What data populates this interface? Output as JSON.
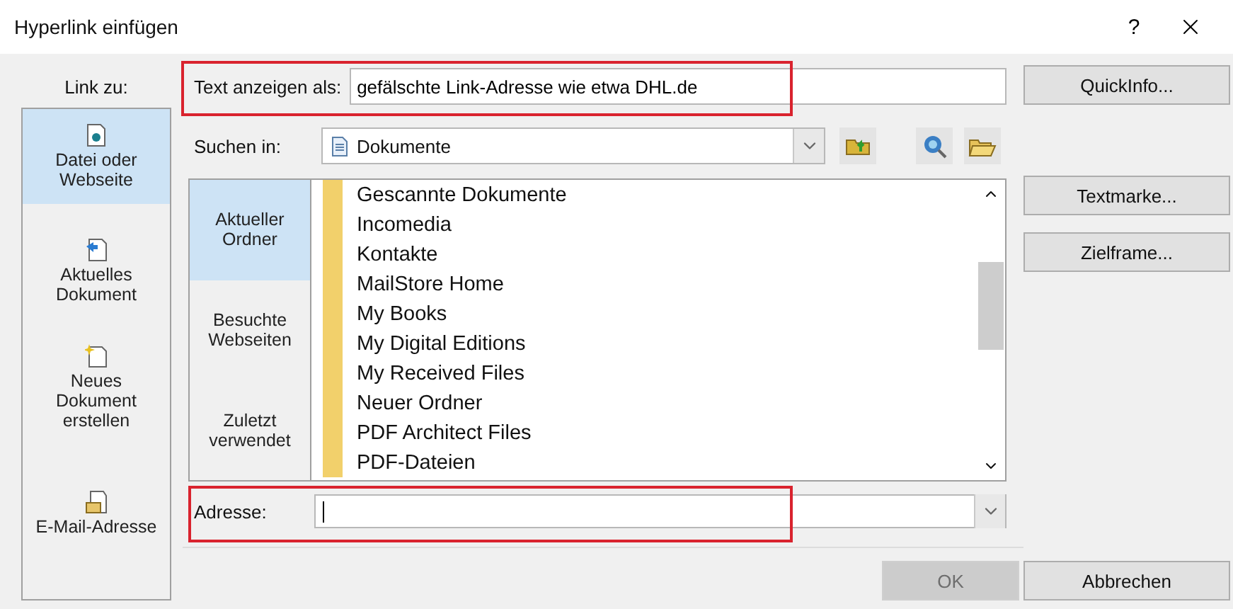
{
  "window": {
    "title": "Hyperlink einfügen",
    "help": "?"
  },
  "link_to": {
    "label": "Link zu:",
    "items": [
      {
        "kind": "file",
        "label": "Datei oder\nWebseite",
        "selected": true
      },
      {
        "kind": "document",
        "label": "Aktuelles\nDokument",
        "selected": false
      },
      {
        "kind": "new",
        "label": "Neues\nDokument\nerstellen",
        "selected": false
      },
      {
        "kind": "mail",
        "label": "E-Mail-Adresse",
        "selected": false
      }
    ]
  },
  "display_text": {
    "label": "Text anzeigen als:",
    "value": "gefälschte Link-Adresse wie etwa DHL.de",
    "highlighted": true
  },
  "look_in": {
    "label": "Suchen in:",
    "value": "Dokumente"
  },
  "places": [
    {
      "label": "Aktueller\nOrdner",
      "selected": true
    },
    {
      "label": "Besuchte\nWebseiten",
      "selected": false
    },
    {
      "label": "Zuletzt\nverwendet",
      "selected": false
    }
  ],
  "files": [
    "Gescannte Dokumente",
    "Incomedia",
    "Kontakte",
    "MailStore Home",
    "My Books",
    "My Digital Editions",
    "My Received Files",
    "Neuer Ordner",
    "PDF Architect Files",
    "PDF-Dateien"
  ],
  "address": {
    "label": "Adresse:",
    "highlighted": true
  },
  "side_buttons": [
    "QuickInfo...",
    "Textmarke...",
    "Zielframe..."
  ],
  "ok": {
    "label": "OK",
    "disabled": true
  },
  "cancel": {
    "label": "Abbrechen"
  }
}
